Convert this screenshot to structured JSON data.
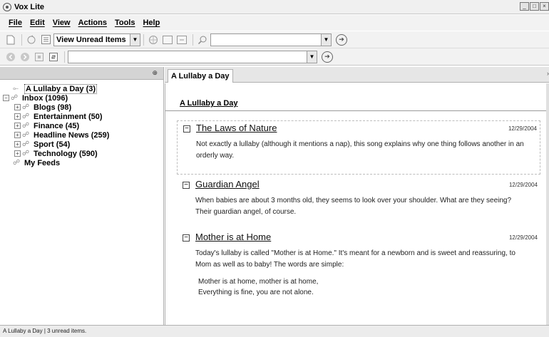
{
  "window": {
    "title": "Vox Lite"
  },
  "menu": [
    "File",
    "Edit",
    "View",
    "Actions",
    "Tools",
    "Help"
  ],
  "toolbar": {
    "view_select": "View Unread Items",
    "search_value": "",
    "url_value": ""
  },
  "tree": {
    "items": [
      {
        "label": "A Lullaby a Day (3)",
        "level": 1,
        "selected": true,
        "expander": ""
      },
      {
        "label": "Inbox (1096)",
        "level": 1,
        "selected": false,
        "expander": "−"
      },
      {
        "label": "Blogs (98)",
        "level": 2,
        "selected": false,
        "expander": "+"
      },
      {
        "label": "Entertainment (50)",
        "level": 2,
        "selected": false,
        "expander": "+"
      },
      {
        "label": "Finance (45)",
        "level": 2,
        "selected": false,
        "expander": "+"
      },
      {
        "label": "Headline News (259)",
        "level": 2,
        "selected": false,
        "expander": "+"
      },
      {
        "label": "Sport (54)",
        "level": 2,
        "selected": false,
        "expander": "+"
      },
      {
        "label": "Technology (590)",
        "level": 2,
        "selected": false,
        "expander": "+"
      },
      {
        "label": "My Feeds",
        "level": 1,
        "selected": false,
        "expander": ""
      }
    ]
  },
  "content": {
    "tab_label": "A Lullaby a Day",
    "feed_title": "A Lullaby a Day",
    "items": [
      {
        "title": "The Laws of Nature",
        "date": "12/29/2004",
        "body": "Not exactly a lullaby (although it mentions a nap), this song explains why one thing follows another in an orderly way.",
        "quote": ""
      },
      {
        "title": "Guardian Angel",
        "date": "12/29/2004",
        "body": "When babies are about 3 months old, they seems to look over your shoulder. What are they seeing? Their guardian angel, of course.",
        "quote": ""
      },
      {
        "title": "Mother is at Home",
        "date": "12/29/2004",
        "body": "Today's lullaby is called \"Mother is at Home.\" It's meant for a newborn and is sweet and reassuring, to Mom as well as to baby! The words are simple:",
        "quote_lines": [
          "Mother is at home, mother is at home,",
          "Everything is fine, you are not alone."
        ]
      }
    ]
  },
  "status": {
    "text": "A Lullaby a Day | 3 unread items."
  }
}
